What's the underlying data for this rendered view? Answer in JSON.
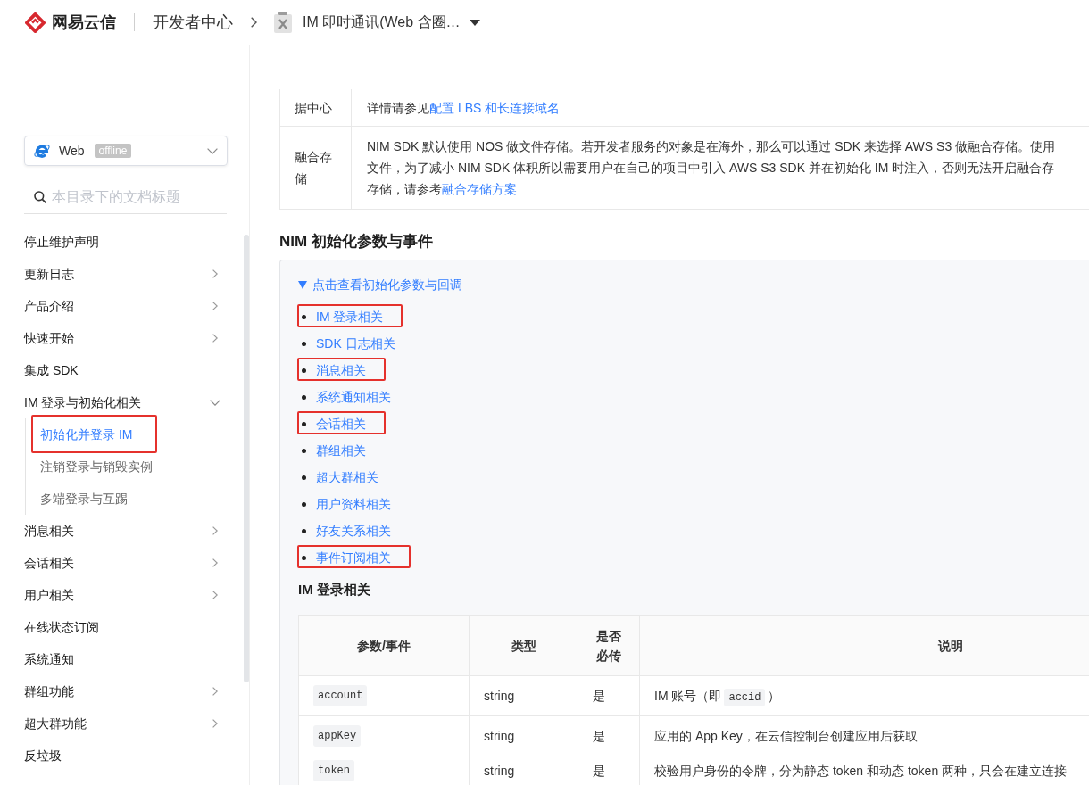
{
  "header": {
    "brand": "网易云信",
    "section": "开发者中心",
    "product": "IM 即时通讯(Web 含圈…"
  },
  "sidebar": {
    "platform_select": {
      "value": "Web",
      "badge": "offline"
    },
    "search": {
      "placeholder": "本目录下的文档标题"
    },
    "items": [
      {
        "kind": "page",
        "label": "停止维护声明",
        "selected": false
      },
      {
        "kind": "group",
        "label": "更新日志",
        "selected": false,
        "expanded": false
      },
      {
        "kind": "group",
        "label": "产品介绍",
        "selected": false,
        "expanded": false
      },
      {
        "kind": "group",
        "label": "快速开始",
        "selected": false,
        "expanded": false
      },
      {
        "kind": "page",
        "label": "集成 SDK",
        "selected": false
      },
      {
        "kind": "group",
        "label": "IM 登录与初始化相关",
        "selected": false,
        "expanded": true,
        "children": [
          {
            "label": "初始化并登录 IM",
            "selected": true,
            "annotated": true
          },
          {
            "label": "注销登录与销毁实例",
            "selected": false,
            "annotated": false
          },
          {
            "label": "多端登录与互踢",
            "selected": false,
            "annotated": false
          }
        ]
      },
      {
        "kind": "group",
        "label": "消息相关",
        "selected": false,
        "expanded": false
      },
      {
        "kind": "group",
        "label": "会话相关",
        "selected": false,
        "expanded": false
      },
      {
        "kind": "group",
        "label": "用户相关",
        "selected": false,
        "expanded": false
      },
      {
        "kind": "page",
        "label": "在线状态订阅",
        "selected": false
      },
      {
        "kind": "page",
        "label": "系统通知",
        "selected": false
      },
      {
        "kind": "group",
        "label": "群组功能",
        "selected": false,
        "expanded": false
      },
      {
        "kind": "group",
        "label": "超大群功能",
        "selected": false,
        "expanded": false
      },
      {
        "kind": "page",
        "label": "反垃圾",
        "selected": false
      }
    ]
  },
  "content": {
    "config_table": {
      "rows": [
        {
          "label": "据中心",
          "lines": [
            "详情请参见"
          ],
          "link": "配置 LBS 和长连接域名"
        },
        {
          "label": "融合存储",
          "lines": [
            "NIM SDK 默认使用 NOS 做文件存储。若开发者服务的对象是在海外，那么可以通过 SDK 来选择 AWS S3 做融合存储。使用",
            "文件，为了减小 NIM SDK 体积所以需要用户在自己的项目中引入 AWS S3 SDK 并在初始化 IM 时注入，否则无法开启融合存",
            "存储，请参考"
          ],
          "link": "融合存储方案"
        }
      ]
    },
    "heading": "NIM 初始化参数与事件",
    "details": {
      "summary": "点击查看初始化参数与回调",
      "expanded": true,
      "links": [
        {
          "label": "IM 登录相关",
          "annotated": true
        },
        {
          "label": "SDK 日志相关",
          "annotated": false
        },
        {
          "label": "消息相关",
          "annotated": true
        },
        {
          "label": "系统通知相关",
          "annotated": false
        },
        {
          "label": "会话相关",
          "annotated": true
        },
        {
          "label": "群组相关",
          "annotated": false
        },
        {
          "label": "超大群相关",
          "annotated": false
        },
        {
          "label": "用户资料相关",
          "annotated": false
        },
        {
          "label": "好友关系相关",
          "annotated": false
        },
        {
          "label": "事件订阅相关",
          "annotated": true
        }
      ],
      "subheading": "IM 登录相关",
      "table": {
        "columns": [
          "参数/事件",
          "类型",
          "是否必传",
          "说明"
        ],
        "rows": [
          {
            "name": "account",
            "type": "string",
            "required": "是",
            "description": [
              {
                "kind": "text",
                "text": "IM 账号（即"
              },
              {
                "kind": "code",
                "text": "accid"
              },
              {
                "kind": "text",
                "text": "）"
              }
            ]
          },
          {
            "name": "appKey",
            "type": "string",
            "required": "是",
            "description": [
              {
                "kind": "text",
                "text": "应用的 App Key，在云信控制台创建应用后获取"
              }
            ]
          },
          {
            "name": "token",
            "type": "string",
            "required": "是",
            "description": [
              {
                "kind": "text",
                "text": "校验用户身份的令牌，分为静态 token 和动态 token 两种，只会在建立连接"
              }
            ]
          }
        ]
      }
    }
  }
}
